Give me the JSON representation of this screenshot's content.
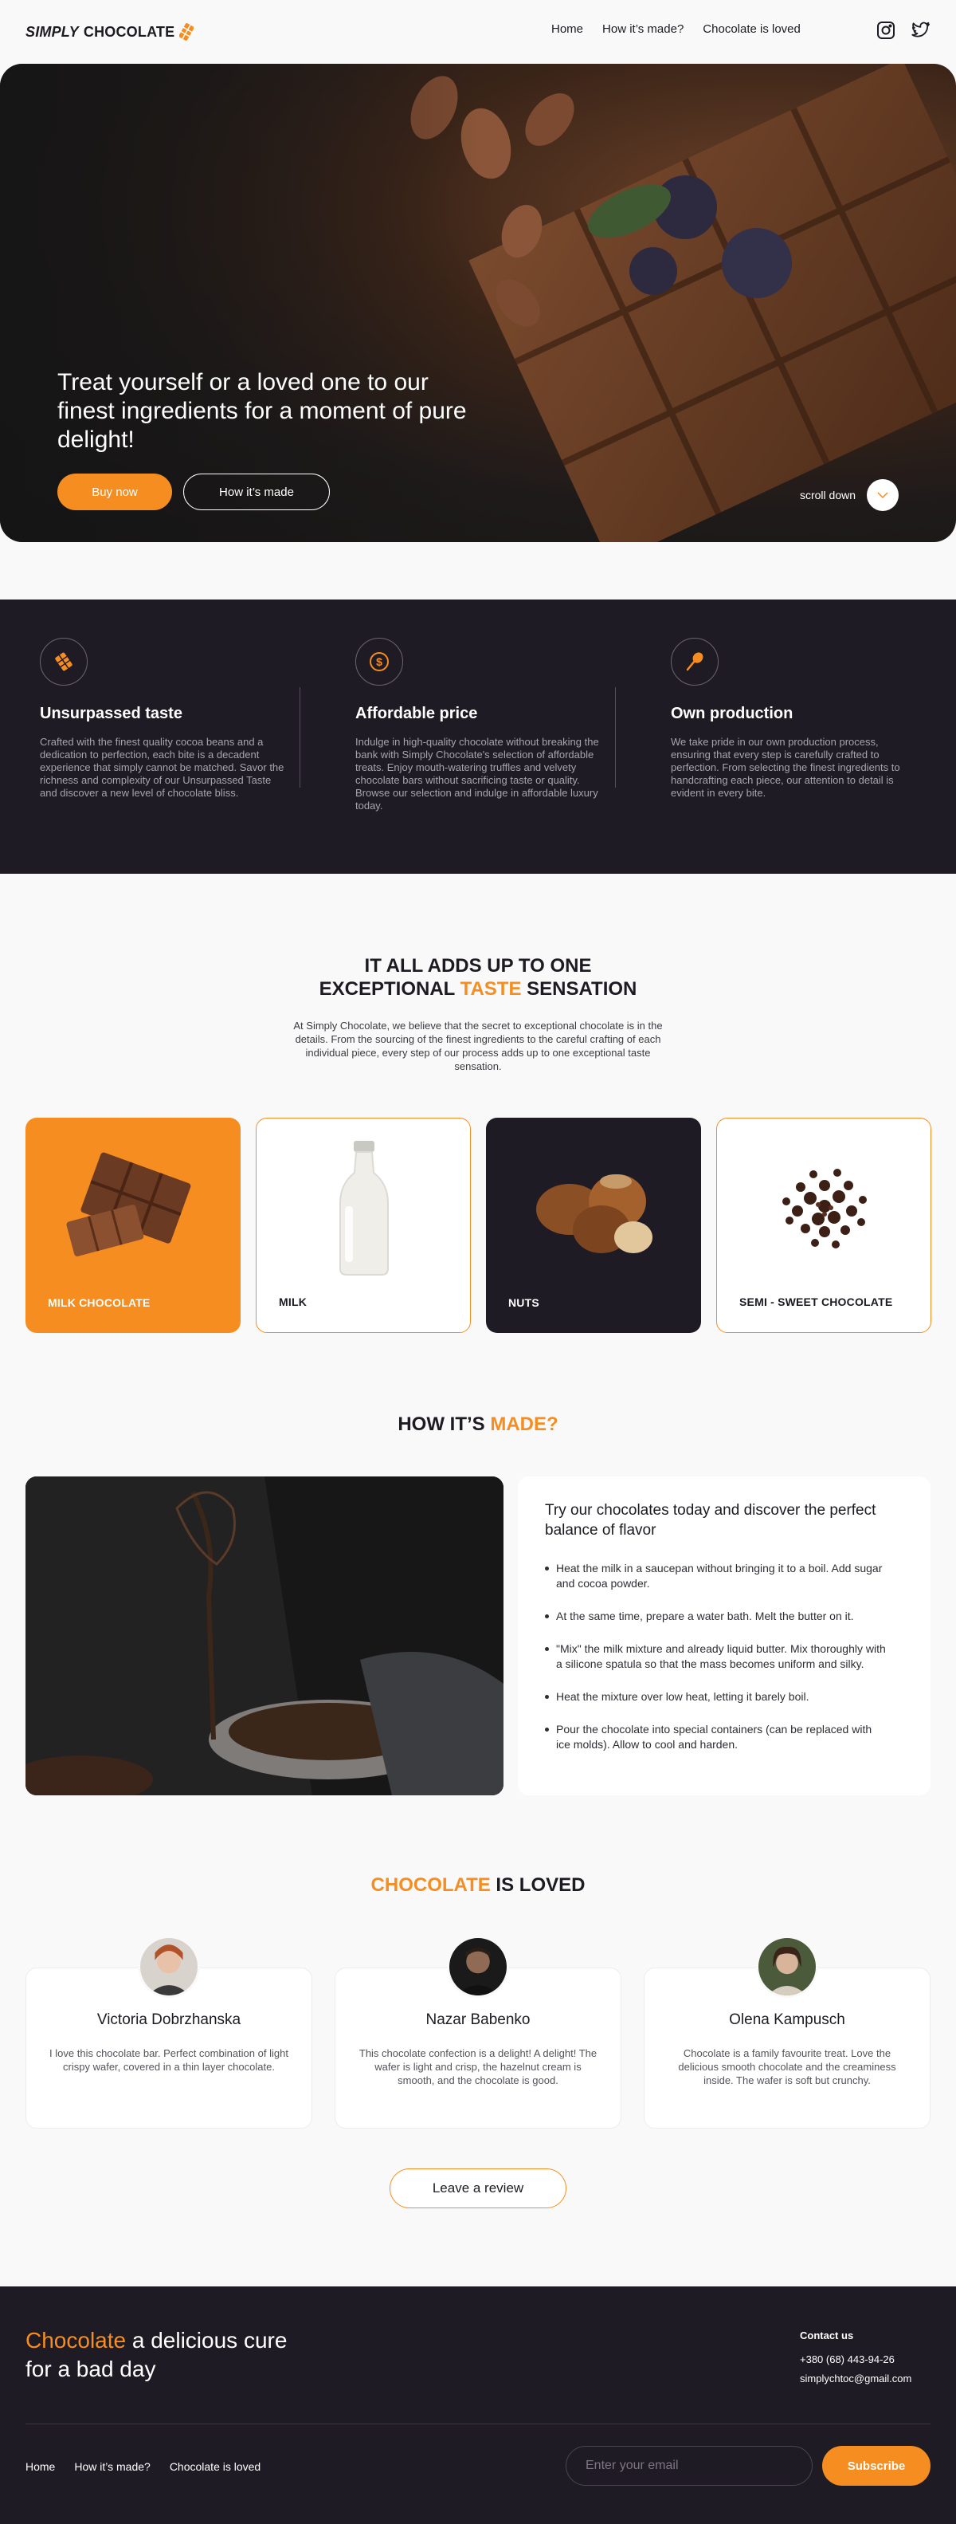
{
  "header": {
    "logo_simply": "SIMPLY",
    "logo_chocolate": "CHOCOLATE",
    "nav": [
      "Home",
      "How it’s made?",
      "Chocolate is loved"
    ]
  },
  "hero": {
    "title": "Treat yourself or a loved one to our finest ingredients for a moment of pure delight!",
    "buy_label": "Buy now",
    "how_label": "How it’s made",
    "scroll_label": "scroll down"
  },
  "features": [
    {
      "title": "Unsurpassed taste",
      "text": "Crafted with the finest quality cocoa beans and a dedication to perfection, each bite is a decadent experience that simply cannot be matched. Savor the richness and complexity of our Unsurpassed Taste and discover a new level of chocolate bliss.",
      "icon": "chocolate-bar-icon"
    },
    {
      "title": "Affordable price",
      "text": "Indulge in high-quality chocolate without breaking the bank with Simply Chocolate's selection of affordable treats. Enjoy mouth-watering truffles and velvety chocolate bars without sacrificing taste or quality. Browse our selection and indulge in affordable luxury today.",
      "icon": "dollar-coin-icon"
    },
    {
      "title": "Own production",
      "text": "We take pride in our own production process, ensuring that every step is carefully crafted to perfection. From selecting the finest ingredients to handcrafting each piece, our attention to detail is evident in every bite.",
      "icon": "whisk-icon"
    }
  ],
  "taste": {
    "title_line1": "IT ALL ADDS UP TO ONE",
    "title_pre": "EXCEPTIONAL ",
    "title_accent": "TASTE",
    "title_post": " SENSATION",
    "text": "At Simply Chocolate, we believe that the secret to exceptional chocolate is in the details. From the sourcing of the finest ingredients to the careful crafting of each individual piece, every step of our process adds up to one exceptional taste sensation.",
    "cards": [
      "MILK CHOCOLATE",
      "MILK",
      "NUTS",
      "SEMI - SWEET CHOCOLATE"
    ]
  },
  "made": {
    "title_pre": "HOW IT’S ",
    "title_accent": "MADE?",
    "box_title": "Try  our chocolates today and discover the perfect balance of flavor",
    "steps": [
      "Heat the milk in a saucepan without bringing it to a boil. Add sugar and cocoa powder.",
      "At the same time, prepare a water bath. Melt the butter on it.",
      "\"Mix\" the milk mixture and already liquid butter. Mix thoroughly with a silicone spatula so that the mass becomes uniform and silky.",
      "Heat the mixture over low heat, letting it barely boil.",
      "Pour the chocolate into special containers (can be replaced with ice molds). Allow to cool and harden."
    ]
  },
  "loved": {
    "title_accent": "CHOCOLATE",
    "title_post": " IS LOVED",
    "reviews": [
      {
        "name": "Victoria Dobrzhanska",
        "text": "I love this chocolate bar. Perfect combination of light crispy wafer, covered in a thin layer chocolate."
      },
      {
        "name": "Nazar Babenko",
        "text": "This chocolate confection is a delight! A delight! The wafer is light and crisp, the hazelnut cream is smooth, and the chocolate is good."
      },
      {
        "name": "Olena Kampusch",
        "text": "Chocolate is a family favourite treat. Love the delicious smooth chocolate and the creaminess inside. The wafer is soft but crunchy."
      }
    ],
    "leave_label": "Leave  a review"
  },
  "footer": {
    "slogan_accent": "Chocolate",
    "slogan_rest": " a delicious cure for a bad day",
    "contact_title": "Contact us",
    "phone": "+380 (68) 443-94-26",
    "email": "simplychtoc@gmail.com",
    "nav": [
      "Home",
      "How it’s made?",
      "Chocolate is loved"
    ],
    "email_placeholder": "Enter your email",
    "subscribe_label": "Subscribe"
  },
  "colors": {
    "accent": "#f68d20",
    "dark": "#1f1b24",
    "background": "#f9f9f9"
  }
}
